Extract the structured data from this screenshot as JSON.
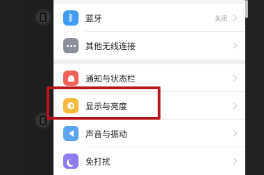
{
  "settings": {
    "groups": [
      {
        "items": [
          {
            "label": "蓝牙",
            "value": "关闭",
            "icon": "bluetooth-icon",
            "icon_color": "#3d9cf2"
          },
          {
            "label": "其他无线连接",
            "value": "",
            "icon": "more-dots-icon",
            "icon_color": "#8a8f99"
          }
        ]
      },
      {
        "items": [
          {
            "label": "通知与状态栏",
            "value": "",
            "icon": "notification-bell-icon",
            "icon_color": "#f06258"
          },
          {
            "label": "显示与亮度",
            "value": "",
            "icon": "brightness-icon",
            "icon_color": "#f6b93b"
          },
          {
            "label": "声音与振动",
            "value": "",
            "icon": "sound-icon",
            "icon_color": "#5aa4f0"
          },
          {
            "label": "免打扰",
            "value": "",
            "icon": "moon-icon",
            "icon_color": "#8f7cf2"
          }
        ]
      }
    ]
  },
  "colors": {
    "highlight_border": "#b8141c",
    "screen_background": "#f5f5f5",
    "row_background": "#ffffff"
  }
}
